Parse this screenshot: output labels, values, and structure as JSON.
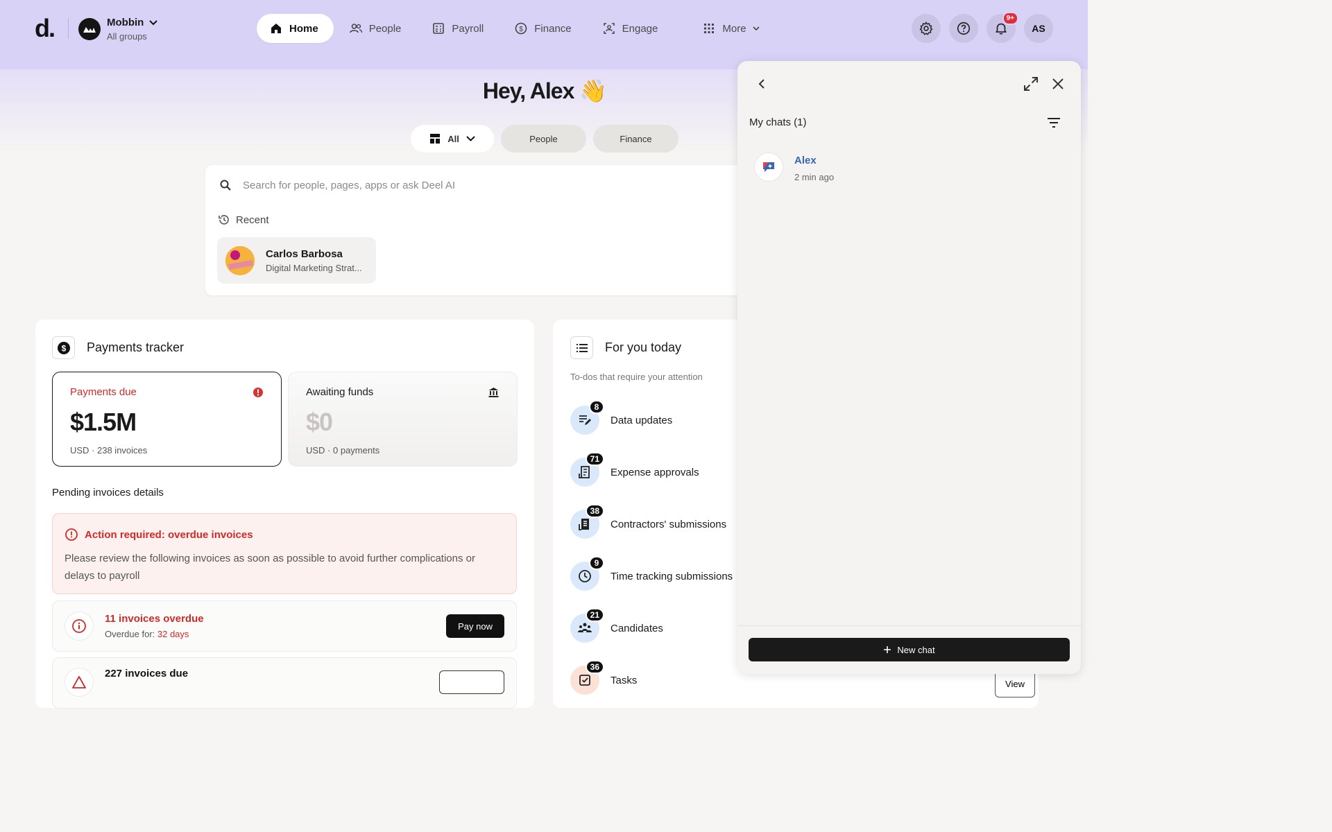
{
  "app": {
    "logo": "d.",
    "org_name": "Mobbin",
    "org_sub": "All groups"
  },
  "nav": {
    "items": [
      {
        "label": "Home",
        "icon": "home-icon"
      },
      {
        "label": "People",
        "icon": "people-icon"
      },
      {
        "label": "Payroll",
        "icon": "payroll-icon"
      },
      {
        "label": "Finance",
        "icon": "dollar-icon"
      },
      {
        "label": "Engage",
        "icon": "engage-icon"
      },
      {
        "label": "More",
        "icon": "grid-icon"
      }
    ],
    "active": "Home"
  },
  "header": {
    "notif_badge": "9+",
    "user_initials": "AS"
  },
  "greeting": {
    "text": "Hey, Alex",
    "emoji": "👋"
  },
  "filters": {
    "all": "All",
    "people": "People",
    "finance": "Finance"
  },
  "search": {
    "placeholder": "Search for people, pages, apps or ask Deel AI",
    "recent_label": "Recent",
    "recent": {
      "name": "Carlos Barbosa",
      "role": "Digital Marketing Strat..."
    }
  },
  "payments": {
    "title": "Payments tracker",
    "due": {
      "label": "Payments due",
      "value": "$1.5M",
      "sub": "USD · 238 invoices"
    },
    "awaiting": {
      "label": "Awaiting funds",
      "value": "$0",
      "sub": "USD · 0 payments"
    },
    "pending_title": "Pending invoices details",
    "alert": {
      "title": "Action required: overdue invoices",
      "text": "Please review the following invoices as soon as possible to avoid further complications or delays to payroll"
    },
    "overdue": {
      "title": "11 invoices overdue",
      "sub_prefix": "Overdue for: ",
      "sub_value": "32 days",
      "button": "Pay now"
    },
    "due_row": {
      "title": "227 invoices due"
    }
  },
  "today": {
    "title": "For you today",
    "subtitle": "To-dos that require your attention",
    "items": [
      {
        "label": "Data updates",
        "count": "8"
      },
      {
        "label": "Expense approvals",
        "count": "71"
      },
      {
        "label": "Contractors' submissions",
        "count": "38"
      },
      {
        "label": "Time tracking submissions",
        "count": "9"
      },
      {
        "label": "Candidates",
        "count": "21"
      },
      {
        "label": "Tasks",
        "count": "36"
      }
    ],
    "view_button": "View"
  },
  "chat": {
    "heading": "My chats (1)",
    "items": [
      {
        "name": "Alex",
        "time": "2 min ago"
      }
    ],
    "new_chat": "New chat"
  },
  "colors": {
    "header_bg": "#d8d2f6",
    "danger": "#cf2a2a",
    "chat_link": "#3a64b0",
    "badge": "#e02d3c"
  }
}
